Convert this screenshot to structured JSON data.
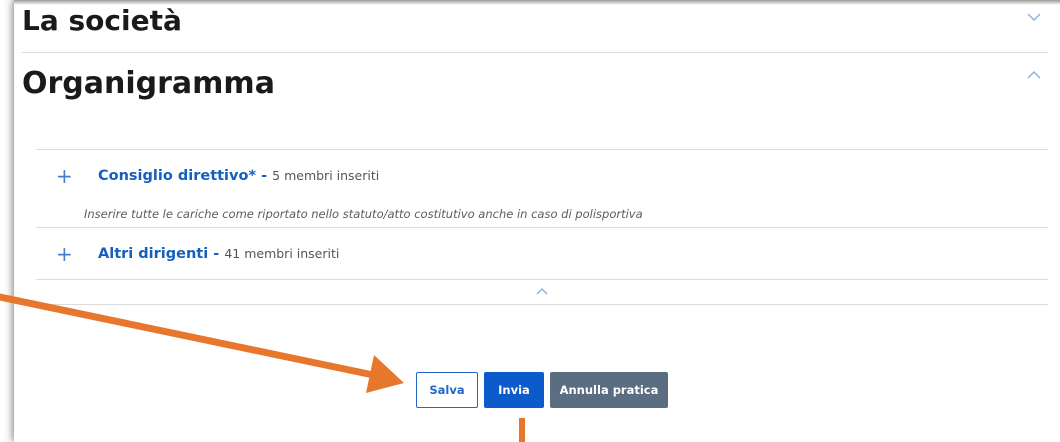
{
  "sections": {
    "societa_title": "La società",
    "organigramma_title": "Organigramma"
  },
  "rows": [
    {
      "plus": "+",
      "label": "Consiglio direttivo*",
      "separator": " - ",
      "count": "5 membri inseriti"
    },
    {
      "plus": "+",
      "label": "Altri dirigenti",
      "separator": " - ",
      "count": "41 membri inseriti"
    }
  ],
  "note": "Inserire tutte le cariche come riportato nello statuto/atto costitutivo anche in caso di polisportiva",
  "buttons": {
    "salva": "Salva",
    "invia": "Invia",
    "annulla": "Annulla pratica"
  },
  "colors": {
    "link": "#155fbf",
    "primary": "#0b5bcb",
    "secondary": "#5b6d80",
    "annotation_arrow": "#e8772e"
  }
}
